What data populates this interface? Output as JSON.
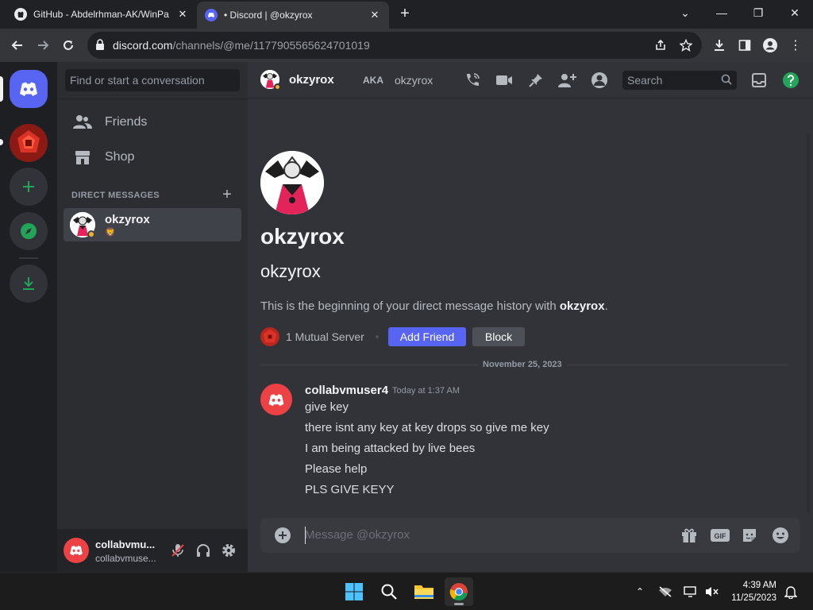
{
  "browser": {
    "tabs": [
      {
        "title": "GitHub - Abdelrhman-AK/WinPa",
        "favicon": "github-icon"
      },
      {
        "title": "• Discord | @okzyrox",
        "favicon": "discord-icon"
      }
    ],
    "url_host": "discord.com",
    "url_path": "/channels/@me/1177905565624701019"
  },
  "sidebar": {
    "search_placeholder": "Find or start a conversation",
    "nav": [
      {
        "label": "Friends",
        "icon": "friends-icon"
      },
      {
        "label": "Shop",
        "icon": "shop-icon"
      }
    ],
    "dm_header": "DIRECT MESSAGES",
    "dms": [
      {
        "name": "okzyrox",
        "status_emoji": "🦁"
      }
    ],
    "user": {
      "name": "collabvmu...",
      "subtext": "collabvmuse..."
    }
  },
  "header": {
    "name": "okzyrox",
    "aka_label": "AKA",
    "aka_name": "okzyrox",
    "search_placeholder": "Search"
  },
  "welcome": {
    "display_name": "okzyrox",
    "username": "okzyrox",
    "intro_text": "This is the beginning of your direct message history with ",
    "intro_name": "okzyrox",
    "intro_end": ".",
    "mutual": "1 Mutual Server",
    "add_friend": "Add Friend",
    "block": "Block"
  },
  "date_divider": "November 25, 2023",
  "message": {
    "author": "collabvmuser4",
    "timestamp": "Today at 1:37 AM",
    "lines": [
      "give key",
      "there isnt any key at key drops so give me key",
      "I am being attacked by live bees",
      "Please help",
      "PLS GIVE KEYY"
    ]
  },
  "composer": {
    "placeholder": "Message @okzyrox"
  },
  "taskbar": {
    "time": "4:39 AM",
    "date": "11/25/2023"
  },
  "colors": {
    "blurple": "#5865f2",
    "green": "#23a559",
    "red": "#ed4245"
  }
}
